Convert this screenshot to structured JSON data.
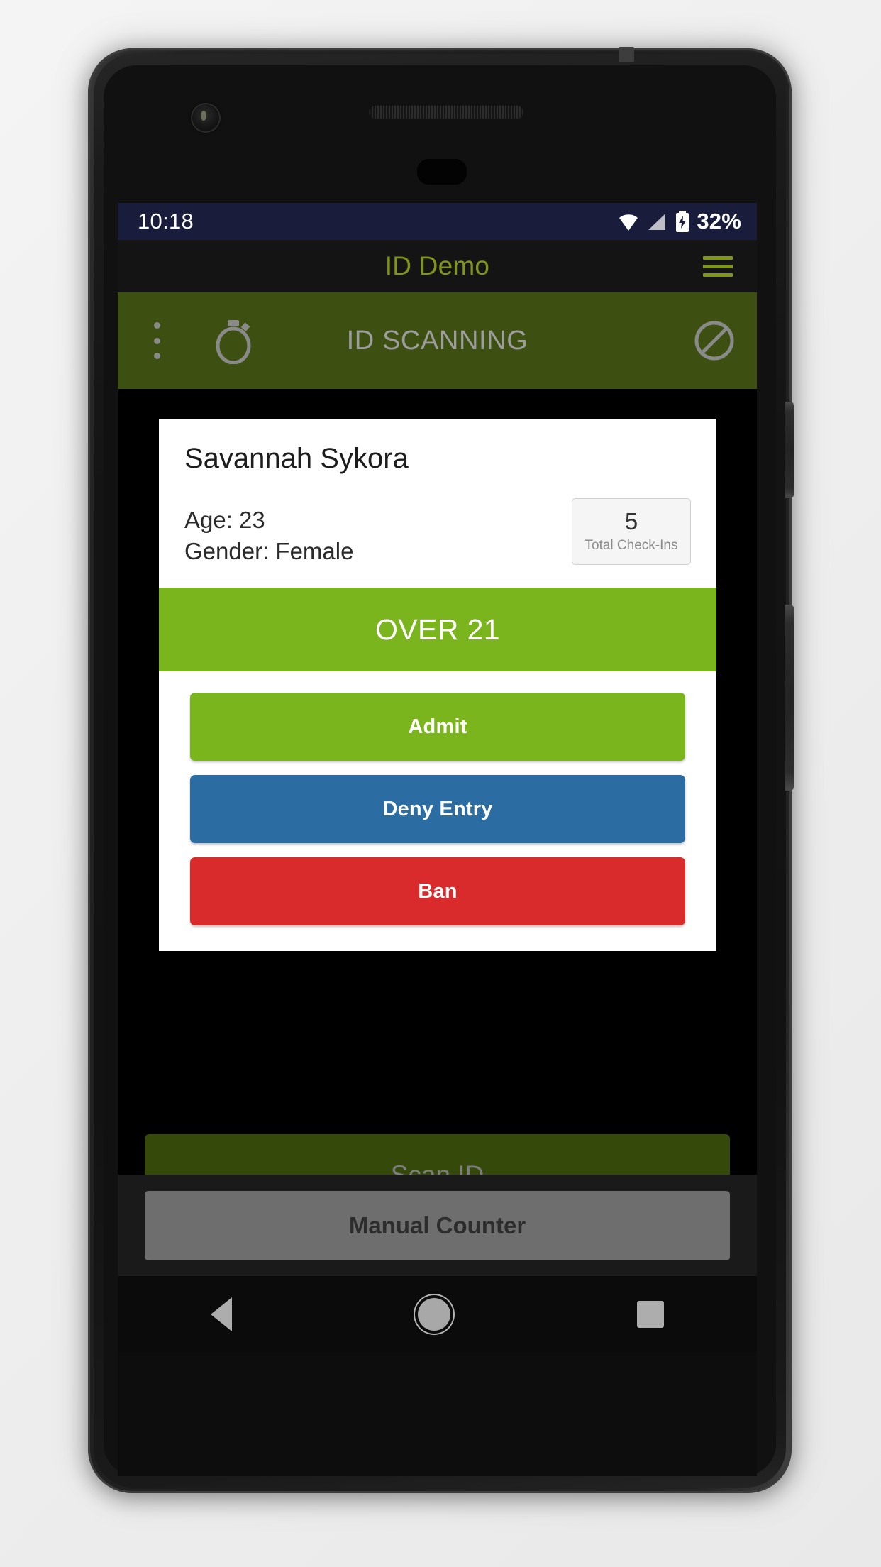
{
  "status_bar": {
    "time": "10:18",
    "battery_percent": "32%",
    "icons": [
      "wifi-icon",
      "cell-signal-icon",
      "battery-charging-icon"
    ],
    "background_color": "#191C3B"
  },
  "app_bar": {
    "title": "ID Demo",
    "title_color": "#7F951C",
    "menu_icon": "hamburger-menu-icon"
  },
  "toolbar": {
    "title": "ID SCANNING",
    "background_color": "#3D5011",
    "left_icons": [
      "list-icon",
      "stopwatch-icon"
    ],
    "right_icon": "block-icon"
  },
  "card": {
    "person_name": "Savannah Sykora",
    "age_label": "Age: 23",
    "gender_label": "Gender: Female",
    "check_ins": {
      "count": "5",
      "label": "Total Check-Ins"
    },
    "status_banner": {
      "text": "OVER 21",
      "color": "#7AB51D"
    },
    "buttons": [
      {
        "label": "Admit",
        "color": "#7AB51D"
      },
      {
        "label": "Deny Entry",
        "color": "#2B6CA3"
      },
      {
        "label": "Ban",
        "color": "#D92B2B"
      }
    ]
  },
  "scan_button": {
    "label": "Scan ID",
    "color": "#35490A",
    "text_color": "#7D7D7D"
  },
  "manual_counter_button": {
    "label": "Manual Counter",
    "color": "#6E6E6E",
    "text_color": "#2D2D2D"
  },
  "nav_bar": {
    "back": "back-triangle-icon",
    "home": "home-circle-icon",
    "recents": "recents-square-icon"
  }
}
